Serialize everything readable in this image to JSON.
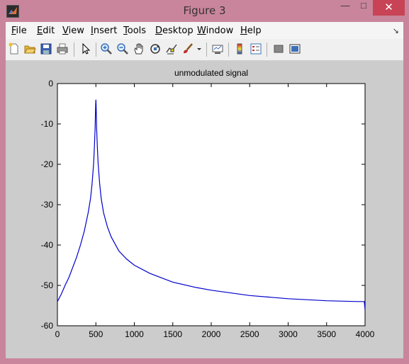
{
  "window": {
    "title": "Figure 3",
    "minimize": "—",
    "maximize": "□",
    "close": "✕"
  },
  "menu": [
    {
      "label": "File",
      "u": "F",
      "rest": "ile"
    },
    {
      "label": "Edit",
      "u": "E",
      "rest": "dit"
    },
    {
      "label": "View",
      "u": "V",
      "rest": "iew"
    },
    {
      "label": "Insert",
      "u": "I",
      "rest": "nsert"
    },
    {
      "label": "Tools",
      "u": "T",
      "rest": "ools"
    },
    {
      "label": "Desktop",
      "u": "D",
      "rest": "esktop"
    },
    {
      "label": "Window",
      "u": "W",
      "rest": "indow"
    },
    {
      "label": "Help",
      "u": "H",
      "rest": "elp"
    }
  ],
  "toolbar": {
    "icons": [
      "new-figure-icon",
      "open-file-icon",
      "save-icon",
      "print-icon",
      "pointer-icon",
      "zoom-in-icon",
      "zoom-out-icon",
      "pan-icon",
      "rotate-3d-icon",
      "data-cursor-icon",
      "brush-icon",
      "link-plot-icon",
      "colorbar-icon",
      "legend-icon",
      "hide-plot-tools-icon",
      "show-plot-tools-icon"
    ]
  },
  "chart_data": {
    "type": "line",
    "title": "unmodulated signal",
    "xlabel": "",
    "ylabel": "",
    "xlim": [
      0,
      4000
    ],
    "ylim": [
      -60,
      0
    ],
    "xticks": [
      0,
      500,
      1000,
      1500,
      2000,
      2500,
      3000,
      3500,
      4000
    ],
    "yticks": [
      0,
      -10,
      -20,
      -30,
      -40,
      -50,
      -60
    ],
    "grid": false,
    "series": [
      {
        "color": "#0000cc",
        "x": [
          0,
          50,
          100,
          150,
          200,
          250,
          300,
          350,
          400,
          430,
          450,
          470,
          480,
          490,
          495,
          498,
          500,
          502,
          505,
          510,
          520,
          530,
          550,
          570,
          600,
          650,
          700,
          800,
          900,
          1000,
          1200,
          1500,
          1800,
          2000,
          2500,
          3000,
          3500,
          3900,
          3990,
          4000
        ],
        "y": [
          -54,
          -52.2,
          -50,
          -48,
          -45.5,
          -43,
          -40,
          -36.5,
          -32,
          -28.5,
          -25,
          -20,
          -16,
          -11,
          -7,
          -5,
          -4,
          -5,
          -7,
          -11,
          -16,
          -20,
          -25,
          -28.5,
          -32,
          -35.5,
          -38,
          -41.5,
          -43.5,
          -45,
          -47,
          -49.2,
          -50.5,
          -51.2,
          -52.5,
          -53.3,
          -53.8,
          -54,
          -54,
          -56
        ]
      }
    ]
  }
}
